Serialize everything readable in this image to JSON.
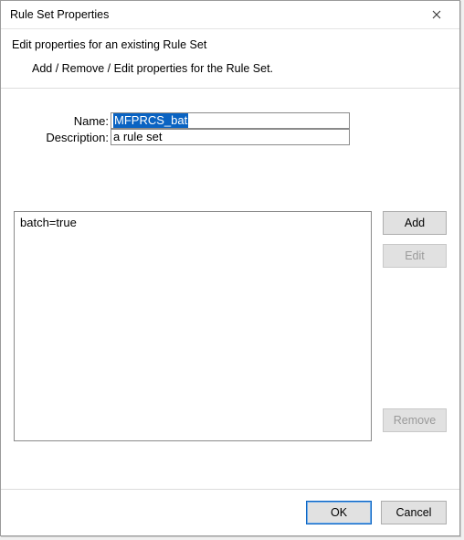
{
  "window": {
    "title": "Rule Set Properties"
  },
  "header": {
    "main": "Edit properties for an existing Rule Set",
    "sub": "Add / Remove / Edit properties for the Rule Set."
  },
  "form": {
    "name_label": "Name:",
    "name_value": "MFPRCS_bat",
    "description_label": "Description:",
    "description_value": "a rule set"
  },
  "list": {
    "items": [
      "batch=true"
    ]
  },
  "buttons": {
    "add": "Add",
    "edit": "Edit",
    "remove": "Remove",
    "ok": "OK",
    "cancel": "Cancel"
  }
}
